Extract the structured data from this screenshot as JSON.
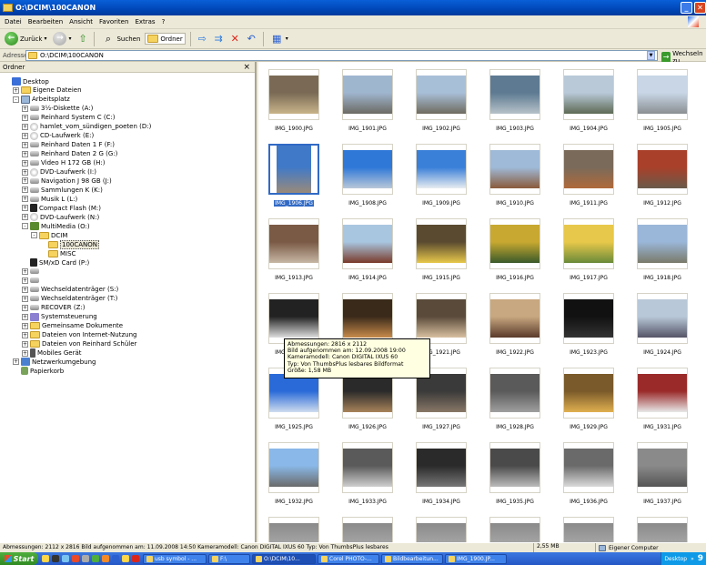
{
  "window": {
    "title": "O:\\DCIM\\100CANON"
  },
  "menu": [
    "Datei",
    "Bearbeiten",
    "Ansicht",
    "Favoriten",
    "Extras",
    "?"
  ],
  "toolbar": {
    "back": "Zurück",
    "search": "Suchen",
    "folders": "Ordner"
  },
  "address": {
    "label": "Adresse",
    "value": "O:\\DCIM\\100CANON",
    "go": "Wechseln zu"
  },
  "folder_pane": {
    "title": "Ordner",
    "close": "×"
  },
  "tree": [
    {
      "label": "Desktop",
      "icon": "desktop-icon"
    },
    {
      "label": "Eigene Dateien",
      "icon": "folder-icon"
    },
    {
      "label": "Arbeitsplatz",
      "icon": "computer-icon"
    },
    {
      "label": "3½-Diskette (A:)",
      "icon": "floppy-icon"
    },
    {
      "label": "Reinhard System C (C:)",
      "icon": "drive-icon"
    },
    {
      "label": "hamlet_vom_sündigen_poeten (D:)",
      "icon": "cd-icon"
    },
    {
      "label": "CD-Laufwerk (E:)",
      "icon": "cd-icon"
    },
    {
      "label": "Reinhard Daten 1 F (F:)",
      "icon": "drive-icon"
    },
    {
      "label": "Reinhard Daten 2 G (G:)",
      "icon": "drive-icon"
    },
    {
      "label": "Video H 172 GB (H:)",
      "icon": "drive-icon"
    },
    {
      "label": "DVD-Laufwerk (I:)",
      "icon": "cd-icon"
    },
    {
      "label": "Navigation J 98 GB (J:)",
      "icon": "drive-icon"
    },
    {
      "label": "Sammlungen K (K:)",
      "icon": "drive-icon"
    },
    {
      "label": "Musik L (L:)",
      "icon": "drive-icon"
    },
    {
      "label": "Compact Flash (M:)",
      "icon": "card-icon"
    },
    {
      "label": "DVD-Laufwerk (N:)",
      "icon": "cd-icon"
    },
    {
      "label": "MultiMedia (O:)",
      "icon": "multimedia-icon"
    },
    {
      "label": "DCIM",
      "icon": "folder-open-icon"
    },
    {
      "label": "100CANON",
      "icon": "folder-open-icon"
    },
    {
      "label": "MISC",
      "icon": "folder-icon"
    },
    {
      "label": "SM/xD Card (P:)",
      "icon": "card-icon"
    },
    {
      "label": "",
      "icon": "drive-icon"
    },
    {
      "label": "",
      "icon": "drive-icon"
    },
    {
      "label": "Wechseldatenträger (S:)",
      "icon": "drive-icon"
    },
    {
      "label": "Wechseldatenträger (T:)",
      "icon": "drive-icon"
    },
    {
      "label": "RECOVER (Z:)",
      "icon": "drive-icon"
    },
    {
      "label": "Systemsteuerung",
      "icon": "control-panel-icon"
    },
    {
      "label": "Gemeinsame Dokumente",
      "icon": "folder-icon"
    },
    {
      "label": "Dateien von Internet-Nutzung",
      "icon": "folder-icon"
    },
    {
      "label": "Dateien von Reinhard Schüler",
      "icon": "folder-icon"
    },
    {
      "label": "Mobiles Gerät",
      "icon": "mobile-icon"
    },
    {
      "label": "Netzwerkumgebung",
      "icon": "network-icon"
    },
    {
      "label": "Papierkorb",
      "icon": "recycle-bin-icon"
    }
  ],
  "files": [
    "IMG_1900.JPG",
    "IMG_1901.JPG",
    "IMG_1902.JPG",
    "IMG_1903.JPG",
    "IMG_1904.JPG",
    "IMG_1905.JPG",
    "IMG_1906.JPG",
    "IMG_1908.JPG",
    "IMG_1909.JPG",
    "IMG_1910.JPG",
    "IMG_1911.JPG",
    "IMG_1912.JPG",
    "IMG_1913.JPG",
    "IMG_1914.JPG",
    "IMG_1915.JPG",
    "IMG_1916.JPG",
    "IMG_1917.JPG",
    "IMG_1918.JPG",
    "IMG_1919.JPG",
    "IMG_1920.JPG",
    "IMG_1921.JPG",
    "IMG_1922.JPG",
    "IMG_1923.JPG",
    "IMG_1924.JPG",
    "IMG_1925.JPG",
    "IMG_1926.JPG",
    "IMG_1927.JPG",
    "IMG_1928.JPG",
    "IMG_1929.JPG",
    "IMG_1931.JPG",
    "IMG_1932.JPG",
    "IMG_1933.JPG",
    "IMG_1934.JPG",
    "IMG_1935.JPG",
    "IMG_1936.JPG",
    "IMG_1937.JPG"
  ],
  "tooltip": [
    "Abmessungen: 2816 x 2112",
    "Bild aufgenommen am: 12.09.2008 19:00",
    "Kameramodell: Canon DIGITAL IXUS 60",
    "Typ: Von ThumbsPlus lesbares Bildformat",
    "Größe: 1,58 MB"
  ],
  "status": {
    "text": "Abmessungen: 2112 x 2816 Bild aufgenommen am: 11.09.2008 14:50 Kameramodell: Canon DIGITAL IXUS 60 Typ: Von ThumbsPlus lesbares",
    "size": "2,55 MB",
    "zone": "Eigener Computer"
  },
  "taskbar": {
    "start": "Start",
    "tasks": [
      "usb symbol - ...",
      "F:\\",
      "O:\\DCIM\\10...",
      "Corel PHOTO-...",
      "Bildbearbeitun...",
      "IMG_1900.JP..."
    ],
    "desktop": "Desktop",
    "clock": "9"
  }
}
